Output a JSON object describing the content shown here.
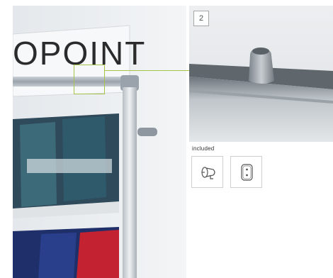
{
  "main_photo": {
    "sign_text": "OPOINT"
  },
  "detail_photo": {
    "step_number": "2"
  },
  "included": {
    "label": "included",
    "parts": [
      {
        "icon": "knob-connector-icon"
      },
      {
        "icon": "mounting-plate-icon"
      }
    ]
  },
  "colors": {
    "callout": "#a6c44a",
    "frame": "#cfcfcf"
  }
}
